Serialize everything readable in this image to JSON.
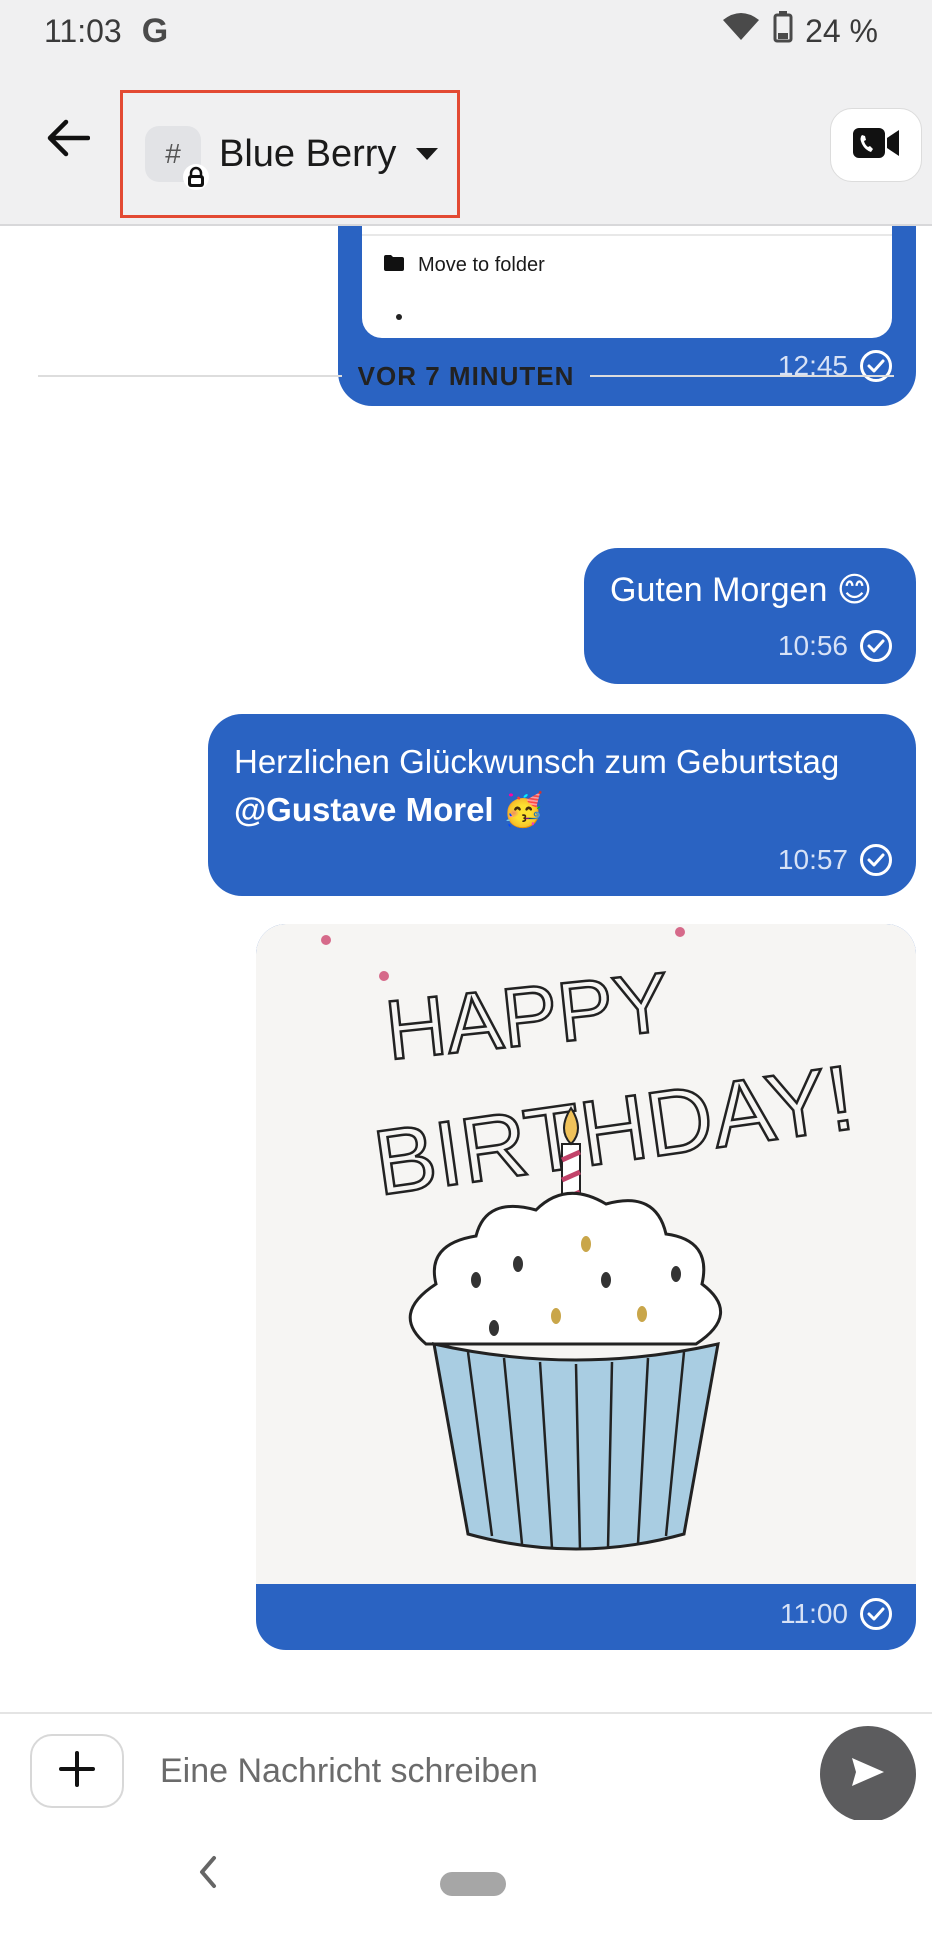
{
  "status_bar": {
    "time": "11:03",
    "google_icon": "G",
    "battery": "24 %",
    "icons": [
      "wifi-icon",
      "battery-icon"
    ]
  },
  "header": {
    "room_name": "Blue Berry",
    "room_avatar_symbol": "#",
    "icons": [
      "back-arrow-icon",
      "lock-icon",
      "chevron-down-icon",
      "video-call-icon"
    ]
  },
  "messages": [
    {
      "card_action": "Move to folder",
      "time": "12:45",
      "status": "sent"
    },
    {
      "divider": "VOR 7 MINUTEN"
    },
    {
      "text": "Guten Morgen 😊",
      "time": "10:56",
      "status": "sent"
    },
    {
      "text_before": "Herzlichen Glückwunsch zum Geburtstag ",
      "mention": "@Gustave Morel",
      "text_after": " 🥳",
      "time": "10:57",
      "status": "sent"
    },
    {
      "image_text": [
        "HAPPY",
        "BIRTHDAY!"
      ],
      "time": "11:00",
      "status": "sent"
    }
  ],
  "composer": {
    "placeholder": "Eine Nachricht schreiben",
    "value": ""
  },
  "colors": {
    "bubble": "#2a63c2",
    "header_bg": "#f0f0f1",
    "highlight": "#e34a33",
    "send_button": "#5c5c5e"
  }
}
